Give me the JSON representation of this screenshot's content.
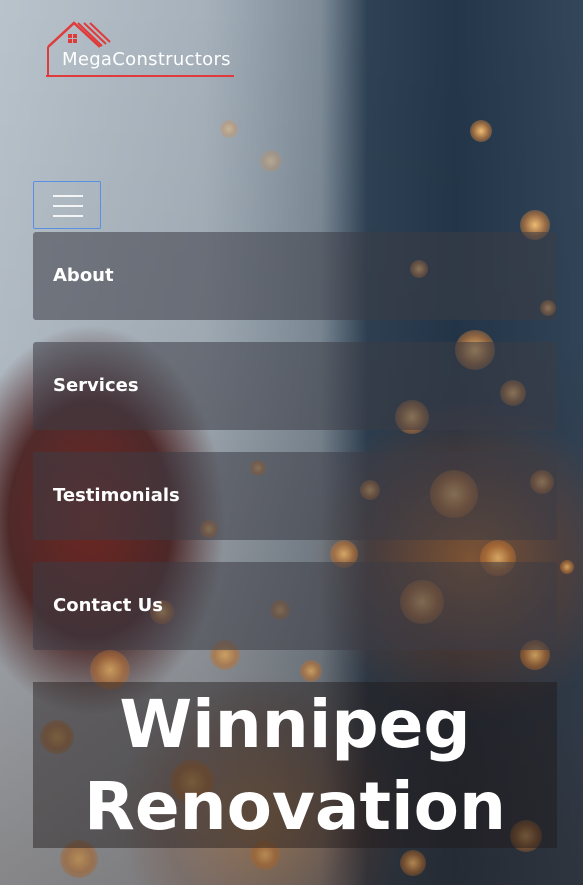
{
  "brand": {
    "name": "MegaConstructors",
    "logo_icon": "house-roof-icon",
    "accent_color": "#e03a3a"
  },
  "menu_toggle": {
    "icon": "hamburger-menu-icon",
    "border_color": "#5a8fe6"
  },
  "nav": {
    "items": [
      {
        "label": "About"
      },
      {
        "label": "Services"
      },
      {
        "label": "Testimonials"
      },
      {
        "label": "Contact Us"
      }
    ]
  },
  "hero": {
    "title_line1": "Winnipeg",
    "title_line2": "Renovation"
  }
}
